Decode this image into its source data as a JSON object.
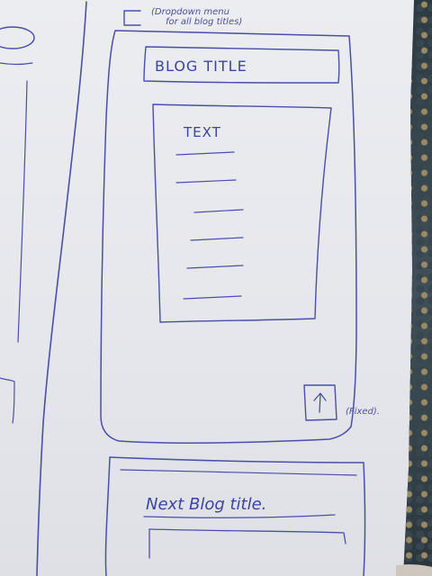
{
  "dropdown": {
    "annotation_line1": "(Dropdown menu",
    "annotation_line2": "for all blog titles)"
  },
  "blog": {
    "title": "BLOG TITLE",
    "text_heading": "TEXT",
    "text_line_count": 7
  },
  "scroll_top": {
    "symbol": "↑",
    "annotation": "(Fixed)."
  },
  "next_post": {
    "title": "Next Blog title."
  }
}
